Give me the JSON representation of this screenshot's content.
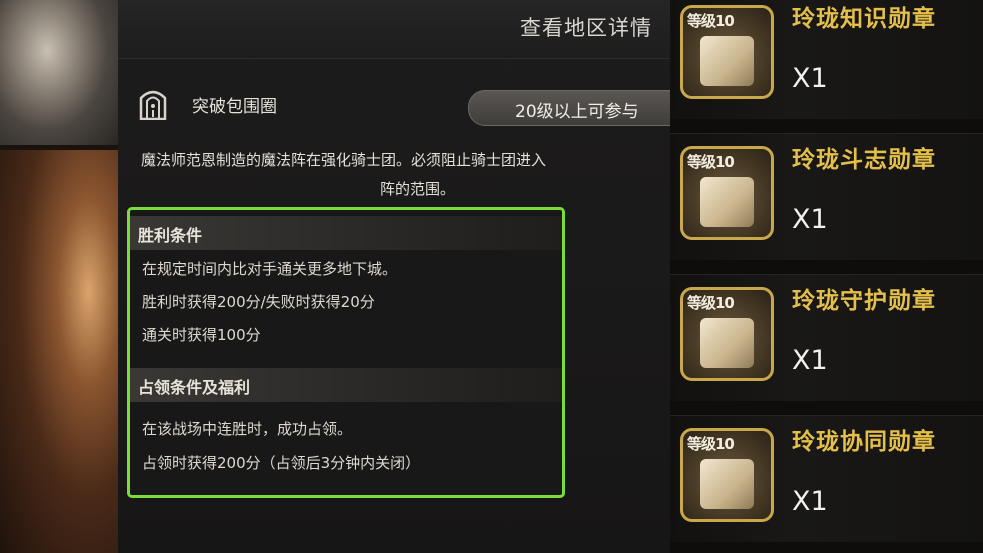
{
  "header": {
    "title": "查看地区详情"
  },
  "stage": {
    "name": "突破包围圈",
    "level_requirement": "20级以上可参与"
  },
  "description": {
    "line1": "魔法师范恩制造的魔法阵在强化骑士团。必须阻止骑士团进入",
    "line2": "阵的范围。"
  },
  "victory": {
    "heading": "胜利条件",
    "lines": [
      "在规定时间内比对手通关更多地下城。",
      "胜利时获得200分/失败时获得20分",
      "通关时获得100分"
    ]
  },
  "occupation": {
    "heading": "占领条件及福利",
    "lines": [
      "在该战场中连胜时，成功占领。",
      "占领时获得200分（占领后3分钟内关闭）"
    ]
  },
  "rewards": [
    {
      "level": "等级10",
      "name": "玲珑知识勋章",
      "qty": "X1",
      "icon": "book-medal-icon"
    },
    {
      "level": "等级10",
      "name": "玲珑斗志勋章",
      "qty": "X1",
      "icon": "crossed-swords-medal-icon"
    },
    {
      "level": "等级10",
      "name": "玲珑守护勋章",
      "qty": "X1",
      "icon": "shield-medal-icon"
    },
    {
      "level": "等级10",
      "name": "玲珑协同勋章",
      "qty": "X1",
      "icon": "handshake-medal-icon"
    }
  ],
  "colors": {
    "highlight_border": "#7cdc3a",
    "reward_name": "#e4c04a",
    "badge_border": "#c8a84b"
  }
}
